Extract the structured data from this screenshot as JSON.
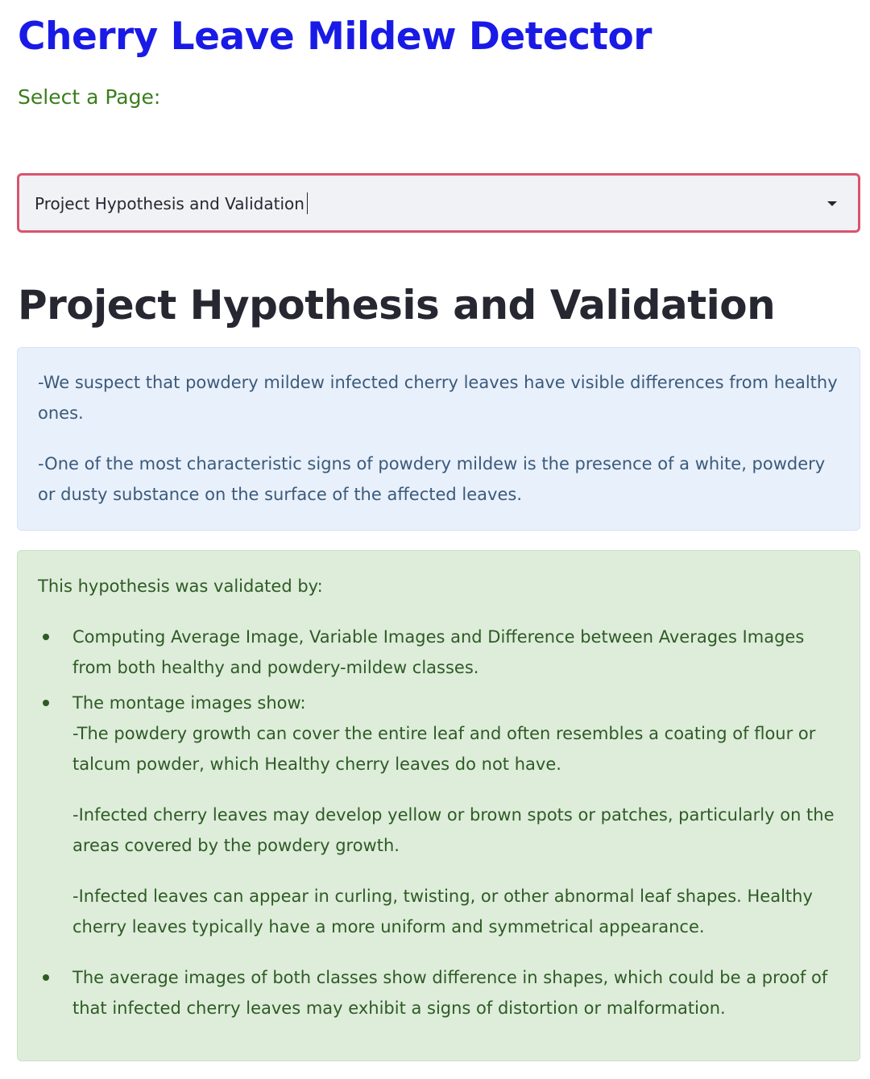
{
  "app": {
    "title": "Cherry Leave Mildew Detector"
  },
  "page_select": {
    "label": "Select a Page:",
    "selected": "Project Hypothesis and Validation"
  },
  "page": {
    "heading": "Project Hypothesis and Validation"
  },
  "info_box": {
    "paragraphs": [
      "-We suspect that powdery mildew infected cherry leaves have visible differences from healthy ones.",
      "-One of the most characteristic signs of powdery mildew is the presence of a white, powdery or dusty substance on the surface of the affected leaves."
    ]
  },
  "success_box": {
    "intro": "This hypothesis was validated by:",
    "bullets": [
      {
        "text": "Computing Average Image, Variable Images and Difference between Averages Images from both healthy and powdery-mildew classes."
      },
      {
        "text": "The montage images show:",
        "sub": [
          "-The powdery growth can cover the entire leaf and often resembles a coating of flour or talcum powder, which Healthy cherry leaves do not have.",
          "-Infected cherry leaves may develop yellow or brown spots or patches, particularly on the areas covered by the powdery growth.",
          "-Infected leaves can appear in curling, twisting, or other abnormal leaf shapes. Healthy cherry leaves typically have a more uniform and symmetrical appearance."
        ]
      },
      {
        "text": "The average images of both classes show difference in shapes, which could be a proof of that infected cherry leaves may exhibit a signs of distortion or malformation."
      }
    ]
  },
  "colors": {
    "title": "#1a1ae6",
    "select_label": "#3b7d1e",
    "select_border": "#d9546c",
    "info_bg": "#e8f0fb",
    "info_text": "#3b5a7a",
    "success_bg": "#ddedda",
    "success_text": "#2f5a25"
  },
  "icons": {
    "select_arrow": "chevron-down-icon"
  }
}
